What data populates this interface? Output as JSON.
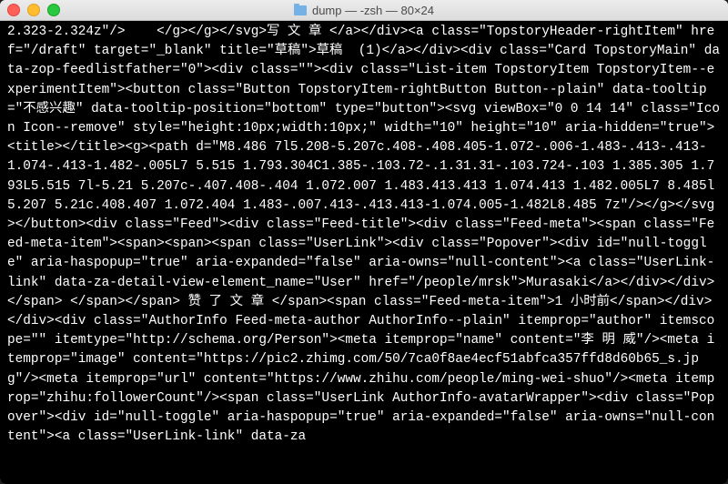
{
  "window": {
    "title": "dump — -zsh — 80×24"
  },
  "terminal": {
    "content": "2.323-2.324z\"/>    </g></g></svg>写 文 章 </a></div><a class=\"TopstoryHeader-rightItem\" href=\"/draft\" target=\"_blank\" title=\"草稿\">草稿  (1)</a></div><div class=\"Card TopstoryMain\" data-zop-feedlistfather=\"0\"><div class=\"\"><div class=\"List-item TopstoryItem TopstoryItem--experimentItem\"><button class=\"Button TopstoryItem-rightButton Button--plain\" data-tooltip=\"不感兴趣\" data-tooltip-position=\"bottom\" type=\"button\"><svg viewBox=\"0 0 14 14\" class=\"Icon Icon--remove\" style=\"height:10px;width:10px;\" width=\"10\" height=\"10\" aria-hidden=\"true\"><title></title><g><path d=\"M8.486 7l5.208-5.207c.408-.408.405-1.072-.006-1.483-.413-.413-1.074-.413-1.482-.005L7 5.515 1.793.304C1.385-.103.72-.1.31.31-.103.724-.103 1.385.305 1.793L5.515 7l-5.21 5.207c-.407.408-.404 1.072.007 1.483.413.413 1.074.413 1.482.005L7 8.485l5.207 5.21c.408.407 1.072.404 1.483-.007.413-.413.413-1.074.005-1.482L8.485 7z\"/></g></svg></button><div class=\"Feed\"><div class=\"Feed-title\"><div class=\"Feed-meta\"><span class=\"Feed-meta-item\"><span><span><span class=\"UserLink\"><div class=\"Popover\"><div id=\"null-toggle\" aria-haspopup=\"true\" aria-expanded=\"false\" aria-owns=\"null-content\"><a class=\"UserLink-link\" data-za-detail-view-element_name=\"User\" href=\"/people/mrsk\">Murasaki</a></div></div></span> </span></span> 赞 了 文 章 </span><span class=\"Feed-meta-item\">1 小时前</span></div></div><div class=\"AuthorInfo Feed-meta-author AuthorInfo--plain\" itemprop=\"author\" itemscope=\"\" itemtype=\"http://schema.org/Person\"><meta itemprop=\"name\" content=\"李 明 威\"/><meta itemprop=\"image\" content=\"https://pic2.zhimg.com/50/7ca0f8ae4ecf51abfca357ffd8d60b65_s.jpg\"/><meta itemprop=\"url\" content=\"https://www.zhihu.com/people/ming-wei-shuo\"/><meta itemprop=\"zhihu:followerCount\"/><span class=\"UserLink AuthorInfo-avatarWrapper\"><div class=\"Popover\"><div id=\"null-toggle\" aria-haspopup=\"true\" aria-expanded=\"false\" aria-owns=\"null-content\"><a class=\"UserLink-link\" data-za"
  }
}
